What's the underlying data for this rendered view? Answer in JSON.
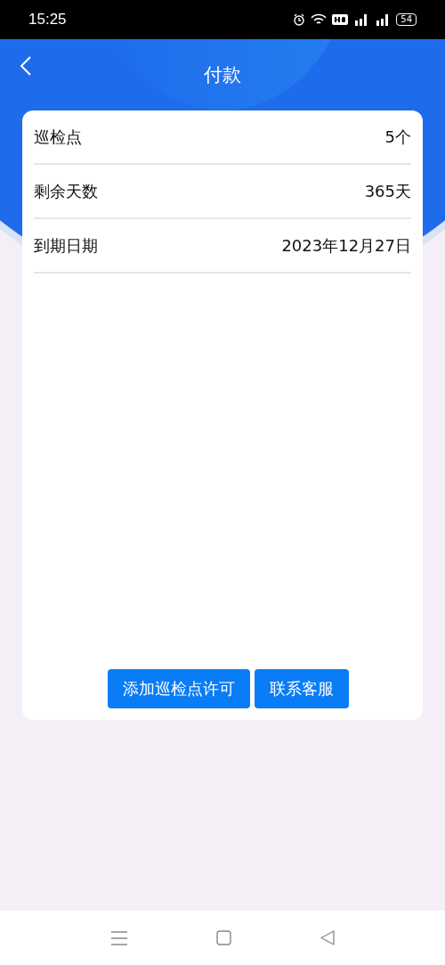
{
  "status_bar": {
    "time": "15:25",
    "battery": "54"
  },
  "header": {
    "title": "付款"
  },
  "info_rows": [
    {
      "label": "巡检点",
      "value": "5个"
    },
    {
      "label": "剩余天数",
      "value": "365天"
    },
    {
      "label": "到期日期",
      "value": "2023年12月27日"
    }
  ],
  "buttons": [
    "添加巡检点许可",
    "联系客服"
  ]
}
